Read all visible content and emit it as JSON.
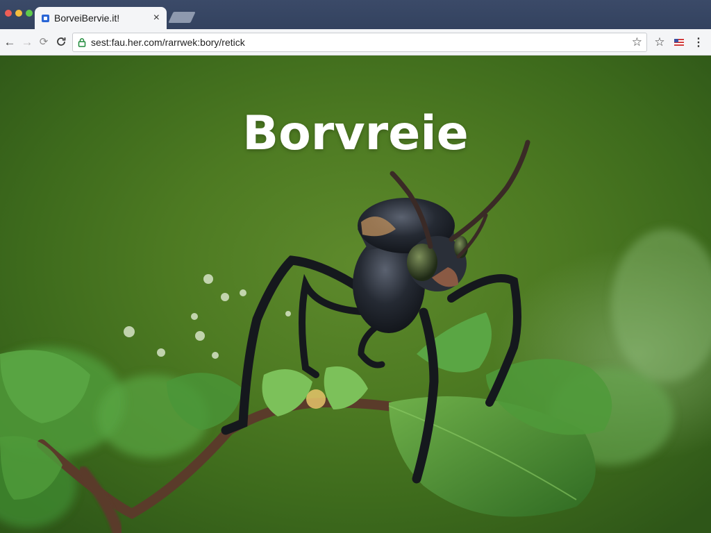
{
  "browser": {
    "tab_title": "BorveiBervie.it!",
    "tab_close": "×",
    "url": "sest:fau.her.com/rarrwek:bory/retick",
    "nav": {
      "back": "←",
      "forward": "→",
      "reload_alt": "⟳",
      "reload": "C"
    },
    "toolbar_icons": {
      "bookmark_in_omnibox": "☆",
      "bookmark": "☆",
      "menu": "⋮"
    }
  },
  "page": {
    "title": "Borvreie"
  }
}
